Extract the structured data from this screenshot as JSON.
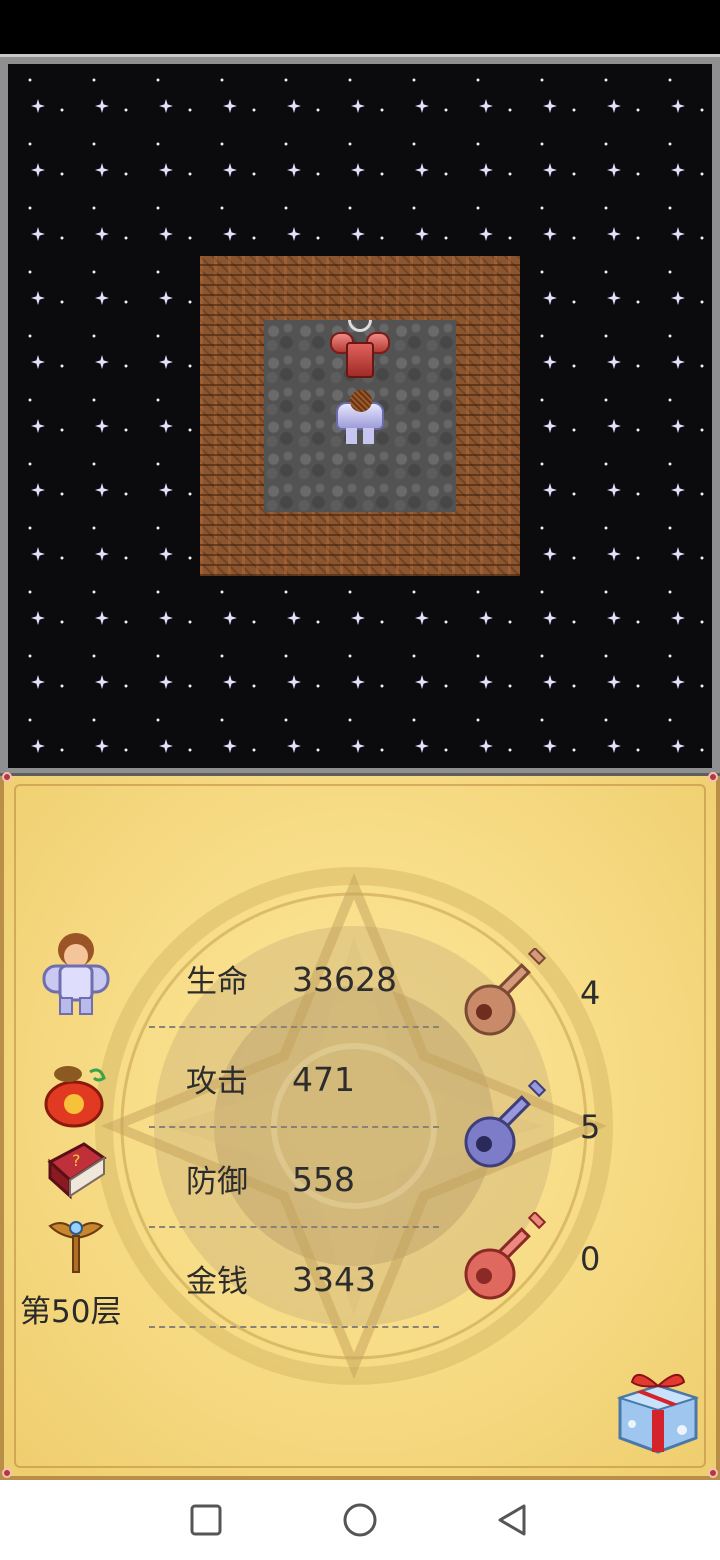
{
  "game": {
    "map": {
      "background": "starfield",
      "wall_tile": "brown-brick-wall",
      "floor_tile": "gray-cobblestone",
      "entities": [
        {
          "name": "red-armored-boss-sprite"
        },
        {
          "name": "hero-sprite"
        }
      ]
    },
    "panel": {
      "stats": [
        {
          "label": "生命",
          "value": "33628"
        },
        {
          "label": "攻击",
          "value": "471"
        },
        {
          "label": "防御",
          "value": "558"
        },
        {
          "label": "金钱",
          "value": "3343"
        }
      ],
      "side_icons": [
        "hero-portrait-icon",
        "lucky-bag-icon",
        "monster-manual-book-icon",
        "fly-wand-icon"
      ],
      "floor_label": "第50层",
      "keys": [
        {
          "name": "yellow-key-icon",
          "color": "#c98a6a",
          "count": "4"
        },
        {
          "name": "blue-key-icon",
          "color": "#7c7cc8",
          "count": "5"
        },
        {
          "name": "red-key-icon",
          "color": "#e0695f",
          "count": "0"
        }
      ],
      "gift_icon": "gift-box-icon"
    }
  },
  "nav_bar": {
    "buttons": [
      "recent-apps-square-icon",
      "home-circle-icon",
      "back-triangle-icon"
    ]
  }
}
